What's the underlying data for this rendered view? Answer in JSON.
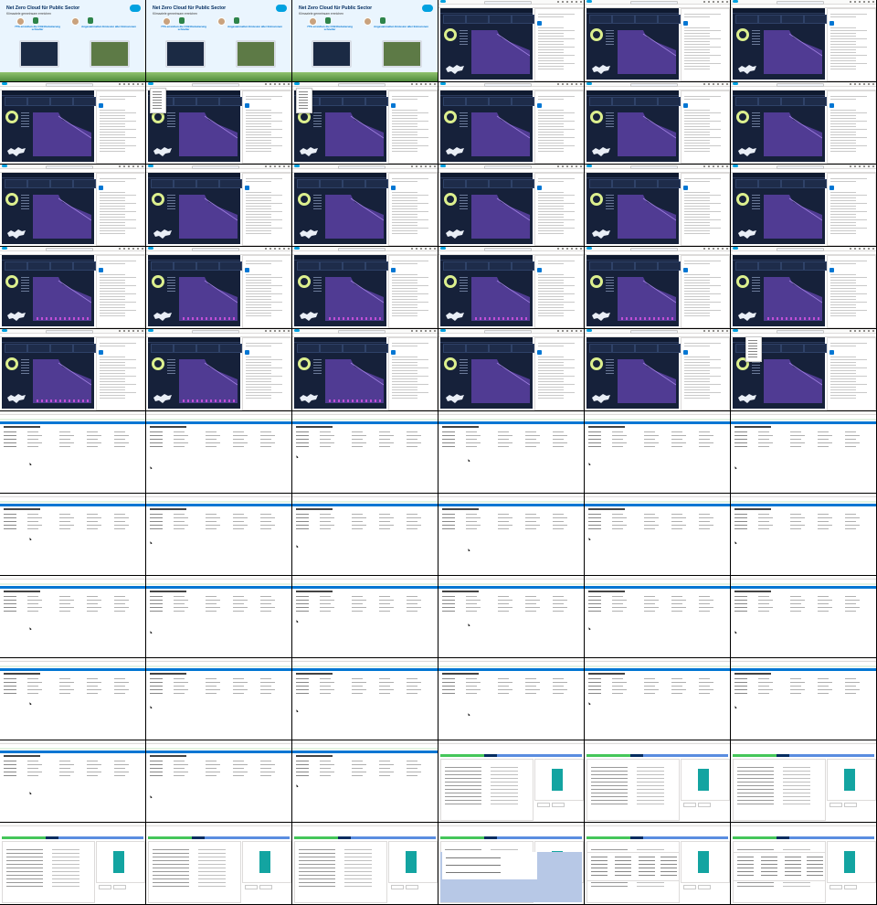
{
  "sheet": {
    "columns": 6,
    "rows": 11,
    "frame_count": 66
  },
  "intro": {
    "title": "Net Zero Cloud für Public Sector",
    "subtitle": "Klimaziele gemeinsam erreichen",
    "left_heading": "77% erreichen die CO2-Reduzierung schneller",
    "left_text": "",
    "right_heading": "Angesammelten Emission aller Emissionen",
    "right_text": ""
  },
  "colors": {
    "brand": "#0176d3",
    "dashboard_bg": "#16213a",
    "ring": "#dcef8e",
    "chart_fill": "#5b3fa3",
    "teal_bar": "#13a4a1",
    "path_green": "#45c65a",
    "path_dark": "#032d60"
  },
  "frames": [
    "intro",
    "intro",
    "intro",
    "dash",
    "dash",
    "dash",
    "dash",
    "dash-menu",
    "dash-menu",
    "dash",
    "dash",
    "dash",
    "dash",
    "dash",
    "dash",
    "dash",
    "dash",
    "dash",
    "dash-bars",
    "dash-bars",
    "dash-bars",
    "dash-bars",
    "dash-bars",
    "dash-bars",
    "dash-bars",
    "dash-bars",
    "dash-bars",
    "dash",
    "dash",
    "dash-ctx",
    "list",
    "list",
    "list",
    "list",
    "list",
    "list",
    "list",
    "list",
    "list",
    "list",
    "list",
    "list",
    "list",
    "list",
    "list",
    "list",
    "list",
    "list",
    "list",
    "list",
    "list",
    "list",
    "list",
    "list",
    "list",
    "list",
    "list",
    "record",
    "record",
    "record",
    "record",
    "record",
    "record",
    "record-modal",
    "record-table",
    "record-table"
  ]
}
